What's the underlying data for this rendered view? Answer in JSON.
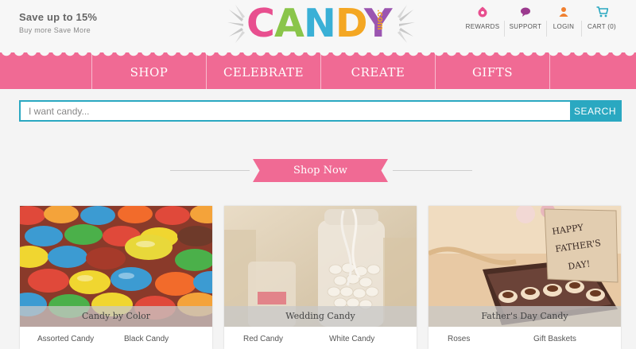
{
  "promo": {
    "title": "Save up to 15%",
    "subtitle": "Buy more Save More"
  },
  "logo": {
    "letters": [
      "C",
      "A",
      "N",
      "D",
      "Y"
    ],
    "suffix": ".com",
    "colors": [
      "#e84f8f",
      "#8ac54a",
      "#3ab0d6",
      "#f4a723",
      "#9b55b0"
    ]
  },
  "utility": [
    {
      "label": "REWARDS",
      "icon": "rewards-icon"
    },
    {
      "label": "SUPPORT",
      "icon": "chat-bubble-icon"
    },
    {
      "label": "LOGIN",
      "icon": "user-icon"
    },
    {
      "label": "CART (0)",
      "icon": "cart-icon"
    }
  ],
  "nav": {
    "items": [
      "SHOP",
      "CELEBRATE",
      "CREATE",
      "GIFTS"
    ]
  },
  "search": {
    "placeholder": "I want candy...",
    "value": "",
    "button": "SEARCH"
  },
  "shop_now": "Shop Now",
  "cards": [
    {
      "caption": "Candy by Color",
      "links": [
        "Assorted Candy",
        "Black Candy"
      ]
    },
    {
      "caption": "Wedding Candy",
      "links": [
        "Red Candy",
        "White Candy"
      ]
    },
    {
      "caption": "Father's Day Candy",
      "links": [
        "Roses",
        "Gift Baskets"
      ],
      "image_text": [
        "HAPPY",
        "FATHER'S",
        "DAY!"
      ]
    }
  ],
  "colors": {
    "brand_pink": "#f06a94",
    "search_teal": "#2aa8c1",
    "background": "#f4f4f4"
  }
}
